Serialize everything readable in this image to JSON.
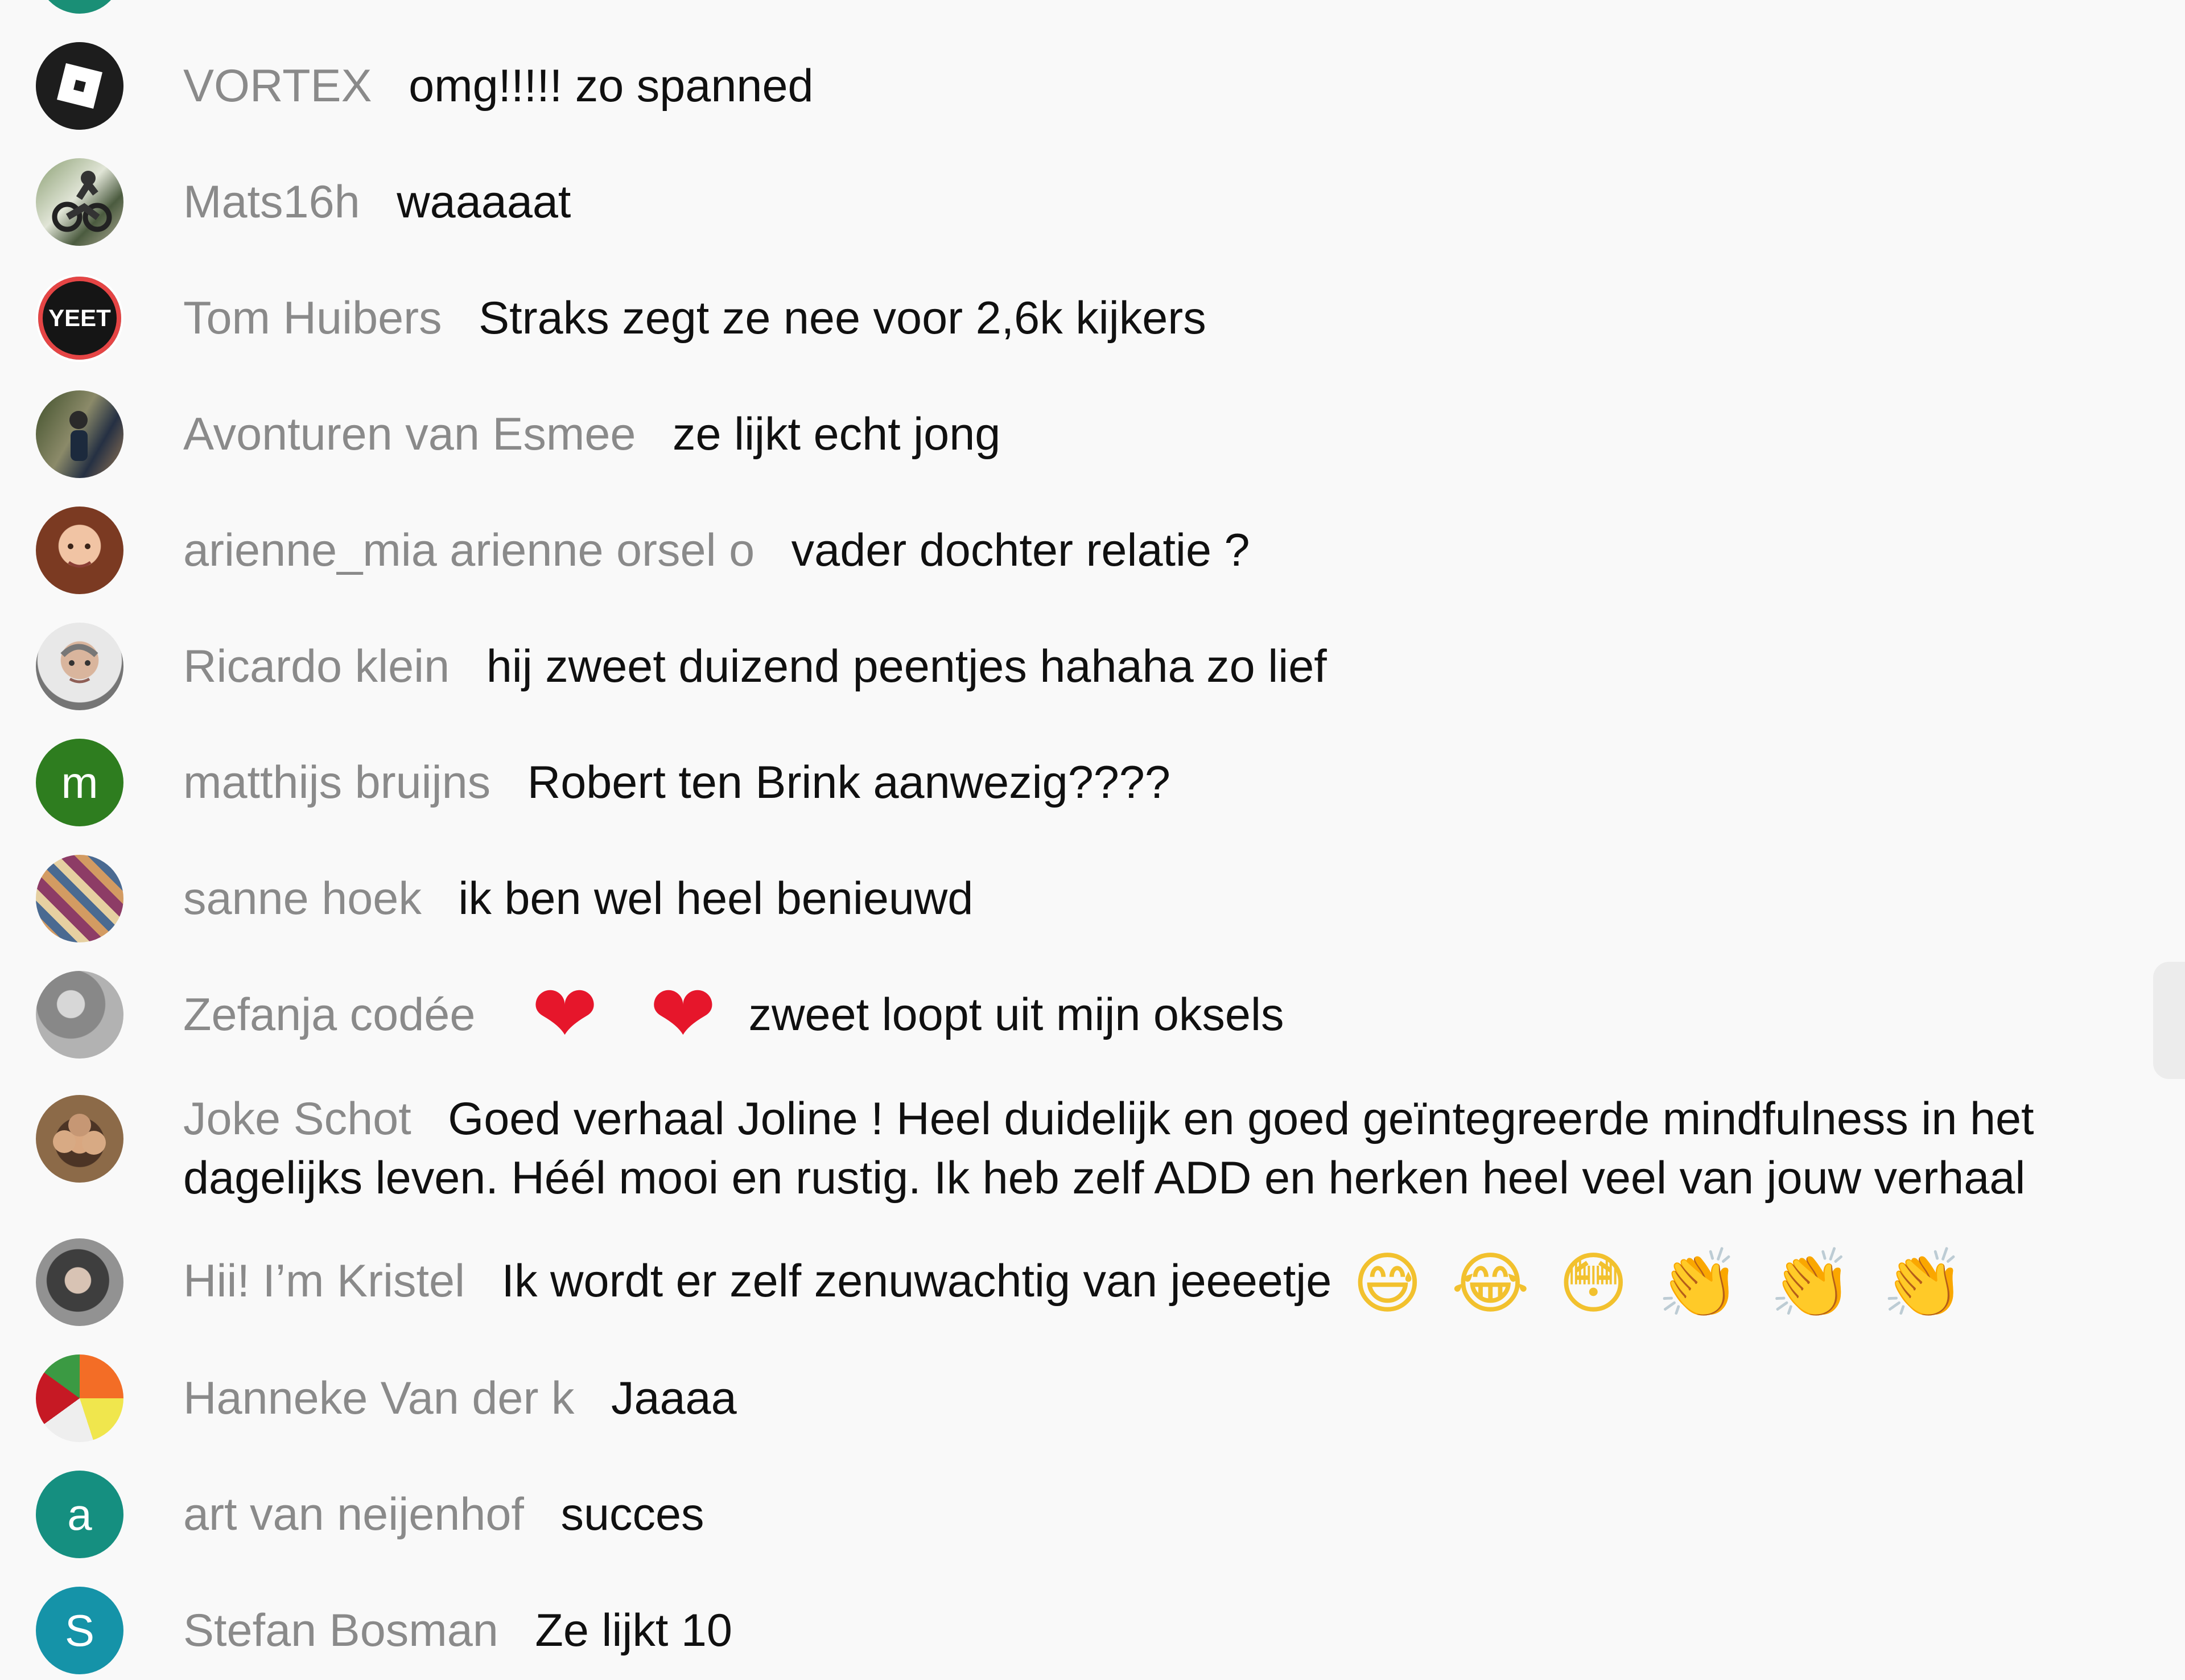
{
  "chat": {
    "messages": [
      {
        "author": "VORTEX",
        "text": "omg!!!!! zo spanned",
        "avatar": "roblox-logo-icon"
      },
      {
        "author": "Mats16h",
        "text": "waaaaat",
        "avatar": "motorbike-photo-avatar"
      },
      {
        "author": "Tom Huibers",
        "text": "Straks zegt ze nee voor 2,6k kijkers",
        "avatar_text": "YEET"
      },
      {
        "author": "Avonturen van Esmee",
        "text": "ze lijkt echt jong",
        "avatar": "outdoor-photo-avatar"
      },
      {
        "author": "arienne_mia arienne orsel o",
        "text": "vader dochter relatie ?",
        "avatar": "face-photo-avatar"
      },
      {
        "author": "Ricardo klein",
        "text": "hij zweet duizend peentjes hahaha zo lief",
        "avatar": "face-photo-avatar"
      },
      {
        "author": "matthijs bruijns",
        "text": "Robert ten Brink aanwezig????",
        "avatar_letter": "m"
      },
      {
        "author": "sanne hoek",
        "text": "ik ben wel heel benieuwd",
        "avatar": "pattern-photo-avatar"
      },
      {
        "author": "Zefanja codée",
        "text": "zweet loopt uit mijn oksels",
        "emojis": [
          "❤",
          "❤"
        ]
      },
      {
        "author": "Joke Schot",
        "text": "Goed verhaal Joline ! Heel duidelijk en goed geïntegreerde mindfulness in het dagelijks leven. Héél mooi en rustig. Ik heb zelf ADD en herken heel veel van jouw verhaal"
      },
      {
        "author": "Hii! I’m Kristel",
        "text": "Ik wordt er zelf zenuwachtig van jeeeetje",
        "emojis": [
          "😅",
          "😂",
          "😳",
          "👏",
          "👏",
          "👏"
        ]
      },
      {
        "author": "Hanneke Van der k",
        "text": "Jaaaa",
        "avatar": "balloons-photo-avatar"
      },
      {
        "author": "art van neijenhof",
        "text": "succes",
        "avatar_letter": "a"
      },
      {
        "author": "Stefan Bosman",
        "text": "Ze lijkt 10",
        "avatar_letter": "S"
      }
    ]
  },
  "colors": {
    "background": "#f9f9f9",
    "author": "#8a8a8a",
    "message": "#101010",
    "green_avatar": "#2e7d1f",
    "teal_avatar": "#158f80",
    "blue_avatar": "#1593a8"
  }
}
